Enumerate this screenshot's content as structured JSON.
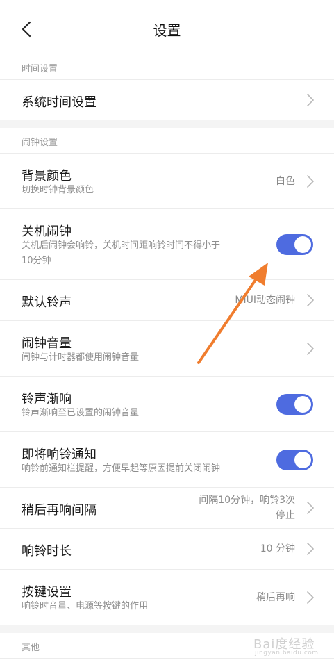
{
  "header": {
    "title": "设置",
    "back_icon": "chevron-left-icon"
  },
  "sections": {
    "time": {
      "label": "时间设置",
      "system_time": {
        "title": "系统时间设置"
      }
    },
    "alarm": {
      "label": "闹钟设置",
      "background_color": {
        "title": "背景颜色",
        "subtitle": "切换时钟背景颜色",
        "value": "白色"
      },
      "power_off_alarm": {
        "title": "关机闹钟",
        "subtitle_line1": "关机后闹钟会响铃，关机时间距响铃时间不得小于",
        "subtitle_line2": "10分钟",
        "enabled": true
      },
      "default_ringtone": {
        "title": "默认铃声",
        "value": "MIUI动态闹钟"
      },
      "alarm_volume": {
        "title": "闹钟音量",
        "subtitle": "闹钟与计时器都使用闹钟音量"
      },
      "ringtone_fade": {
        "title": "铃声渐响",
        "subtitle": "铃声渐响至已设置的闹钟音量",
        "enabled": true
      },
      "upcoming_notice": {
        "title": "即将响铃通知",
        "subtitle": "响铃前通知栏提醒，方便早起等原因提前关闭闹钟",
        "enabled": true
      },
      "snooze_interval": {
        "title": "稍后再响间隔",
        "value_line1": "间隔10分钟，响铃3次",
        "value_line2": "停止"
      },
      "ring_duration": {
        "title": "响铃时长",
        "value": "10 分钟"
      },
      "button_settings": {
        "title": "按键设置",
        "subtitle": "响铃时音量、电源等按键的作用",
        "value": "稍后再响"
      }
    },
    "other": {
      "label": "其他"
    }
  },
  "watermark": {
    "brand": "Bai度经验",
    "sub": "jingyan.baidu.com"
  },
  "colors": {
    "toggle_on": "#4e6be0",
    "annotation_arrow": "#f07d2e",
    "gap_background": "#f4f4f4"
  }
}
